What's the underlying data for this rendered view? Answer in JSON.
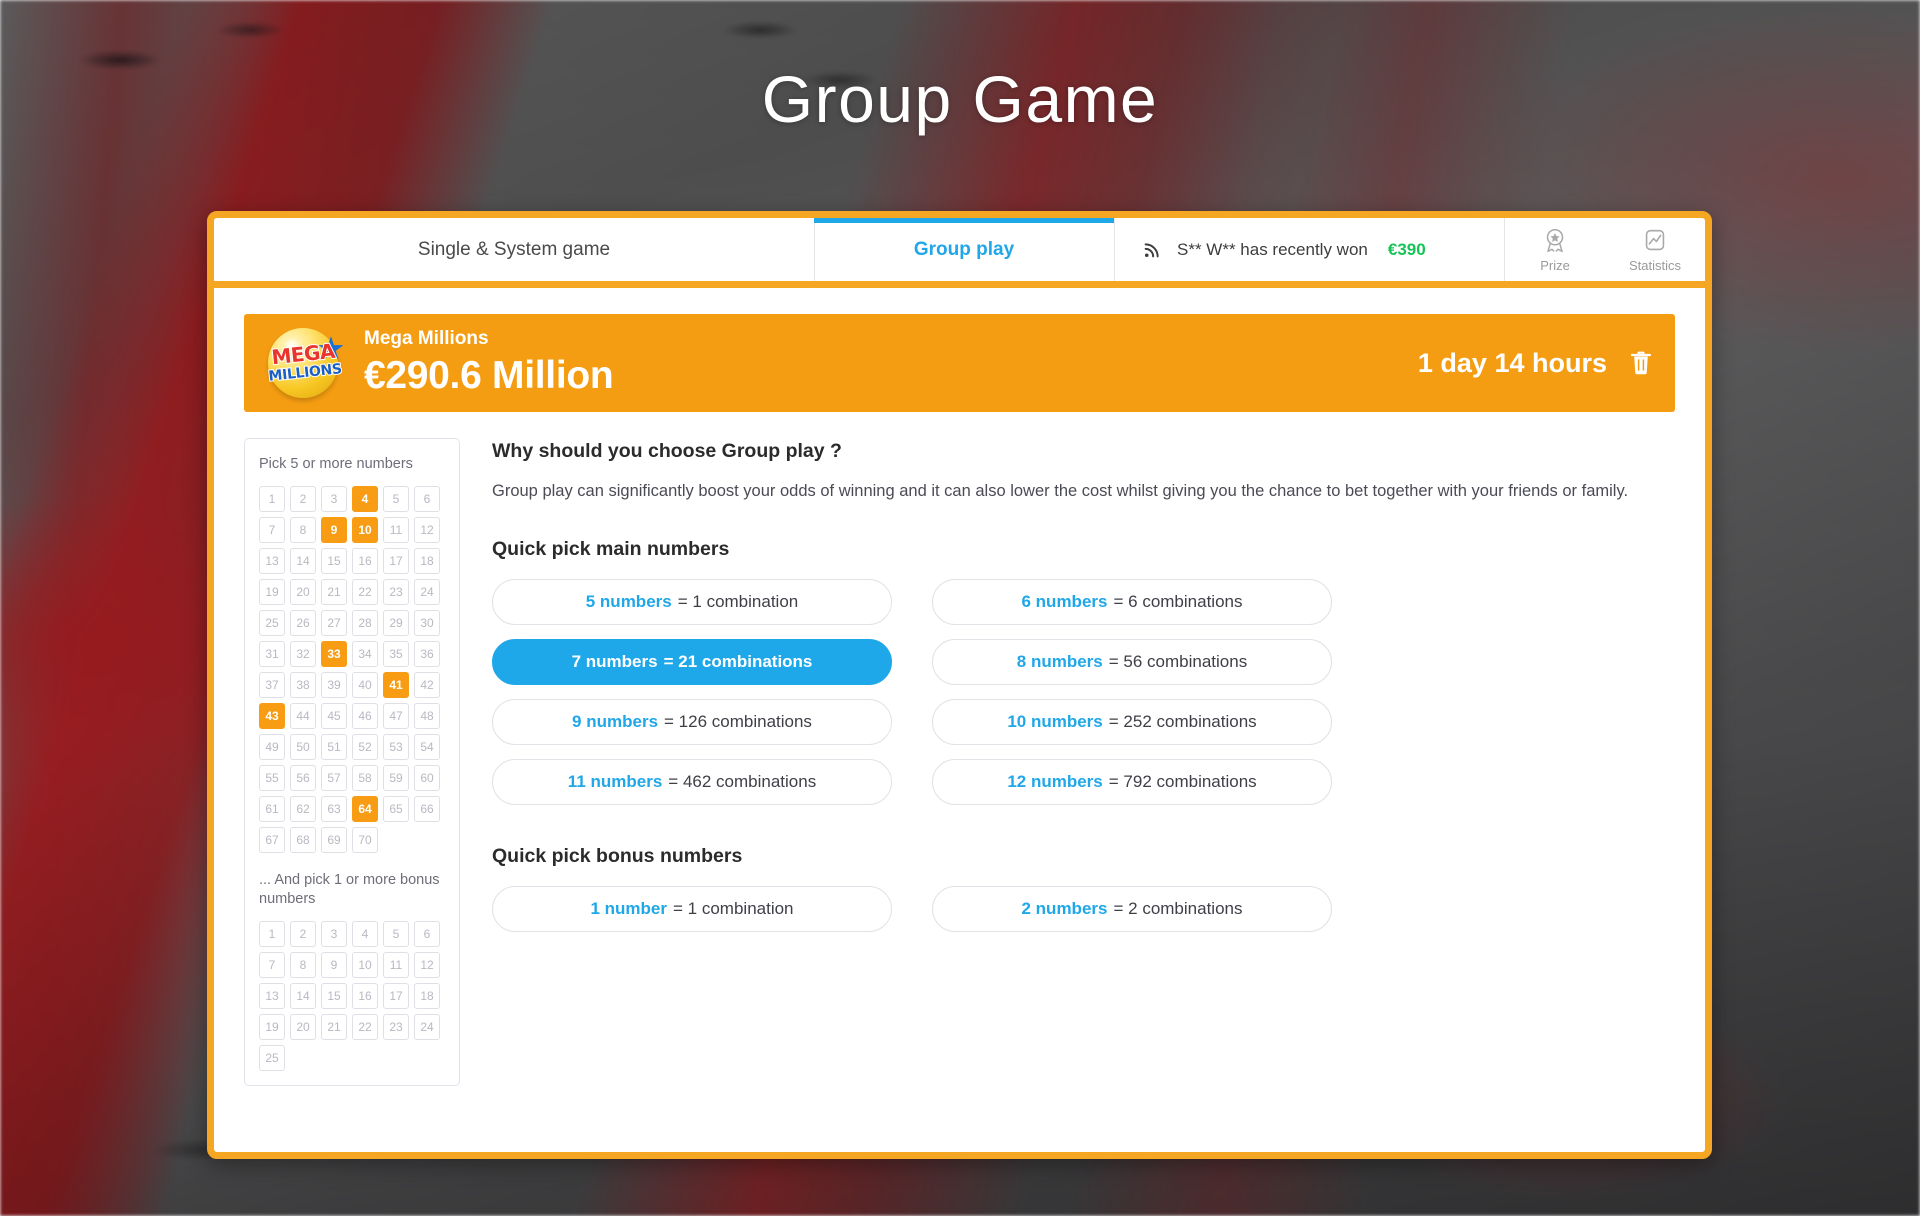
{
  "page_title": "Group Game",
  "colors": {
    "frame_orange": "#f5a623",
    "banner_orange": "#f59d12",
    "accent_blue": "#20a7e8",
    "win_green": "#16c457",
    "selected_number": "#f79c13"
  },
  "tabs": [
    {
      "id": "single",
      "label": "Single & System game",
      "active": false
    },
    {
      "id": "group",
      "label": "Group play",
      "active": true
    }
  ],
  "ticker": {
    "icon": "rss-icon",
    "text": "S** W** has recently won",
    "amount": "€390"
  },
  "header_actions": [
    {
      "id": "prize",
      "icon": "award-icon",
      "label": "Prize"
    },
    {
      "id": "statistics",
      "icon": "chart-icon",
      "label": "Statistics"
    }
  ],
  "jackpot": {
    "logo": {
      "name": "MEGA",
      "sub": "MILLIONS"
    },
    "game_name": "Mega Millions",
    "amount": "€290.6 Million",
    "countdown": "1 day 14 hours",
    "delete_icon": "trash-icon"
  },
  "picker": {
    "main_label": "Pick 5 or more numbers",
    "main_min": 1,
    "main_max": 70,
    "main_selected": [
      4,
      9,
      10,
      33,
      41,
      43,
      64
    ],
    "bonus_label": "... And pick 1 or more bonus numbers",
    "bonus_min": 1,
    "bonus_max": 25,
    "bonus_selected": []
  },
  "info": {
    "why_title": "Why should you choose Group play ?",
    "why_text": "Group play can significantly boost your odds of winning and it can also lower the cost whilst giving you the chance to bet together with your friends or family.",
    "quick_pick_main_title": "Quick pick main numbers",
    "quick_pick_bonus_title": "Quick pick bonus numbers"
  },
  "quick_pick_main": [
    {
      "count": "5 numbers",
      "result": "= 1 combination",
      "active": false
    },
    {
      "count": "6 numbers",
      "result": "= 6 combinations",
      "active": false
    },
    {
      "count": "7 numbers",
      "result": "= 21 combinations",
      "active": true
    },
    {
      "count": "8 numbers",
      "result": "= 56 combinations",
      "active": false
    },
    {
      "count": "9 numbers",
      "result": "= 126 combinations",
      "active": false
    },
    {
      "count": "10 numbers",
      "result": "= 252 combinations",
      "active": false
    },
    {
      "count": "11 numbers",
      "result": "= 462 combinations",
      "active": false
    },
    {
      "count": "12 numbers",
      "result": "= 792 combinations",
      "active": false
    }
  ],
  "quick_pick_bonus": [
    {
      "count": "1 number",
      "result": "= 1 combination",
      "active": false
    },
    {
      "count": "2 numbers",
      "result": "= 2 combinations",
      "active": false
    }
  ]
}
